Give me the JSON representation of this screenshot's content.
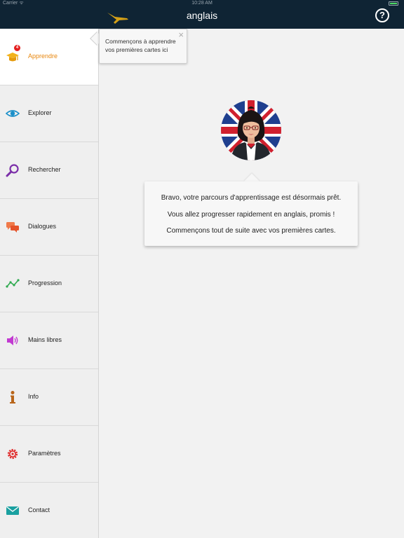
{
  "status_bar": {
    "carrier": "Carrier ᯤ",
    "time": "10:28 AM"
  },
  "nav": {
    "title": "anglais",
    "help_label": "?"
  },
  "sidebar": {
    "items": [
      {
        "label": "Apprendre",
        "icon": "graduation-cap-icon",
        "active": true,
        "badge": "4"
      },
      {
        "label": "Explorer",
        "icon": "eye-icon"
      },
      {
        "label": "Rechercher",
        "icon": "magnifier-icon"
      },
      {
        "label": "Dialogues",
        "icon": "chat-bubbles-icon"
      },
      {
        "label": "Progression",
        "icon": "progress-chart-icon"
      },
      {
        "label": "Mains libres",
        "icon": "speaker-icon"
      },
      {
        "label": "Info",
        "icon": "info-icon"
      },
      {
        "label": "Paramètres",
        "icon": "gear-icon"
      },
      {
        "label": "Contact",
        "icon": "envelope-icon"
      }
    ]
  },
  "tooltip": {
    "text": "Commençons à apprendre vos premières cartes ici",
    "close_label": "×"
  },
  "message": {
    "lines": [
      "Bravo, votre parcours d'apprentissage est désormais prêt.",
      "Vous allez progresser rapidement en anglais, promis !",
      "Commençons tout de suite avec vos premières cartes."
    ]
  },
  "colors": {
    "navbar": "#0f2434",
    "accent": "#e8870e",
    "badge": "#e41e1e"
  }
}
